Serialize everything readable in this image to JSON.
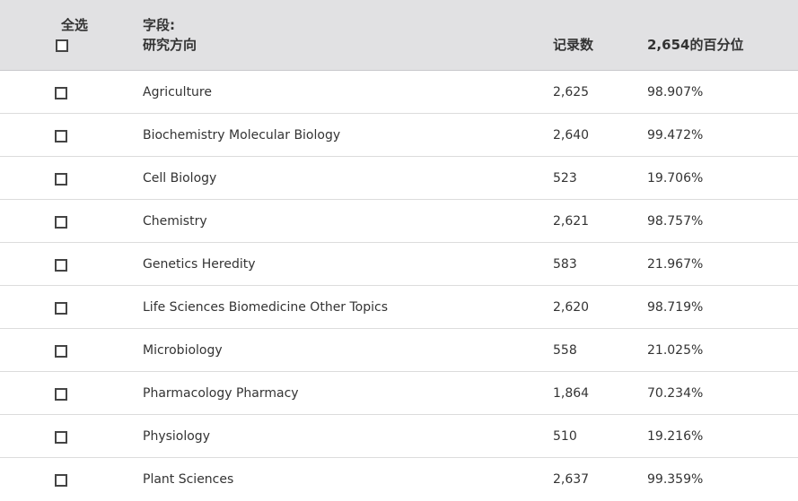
{
  "header": {
    "select_all": "全选",
    "field_label": "字段:",
    "field_name": "研究方向",
    "count": "记录数",
    "percent": "2,654的百分位"
  },
  "rows": [
    {
      "field": "Agriculture",
      "count": "2,625",
      "percent": "98.907%"
    },
    {
      "field": "Biochemistry Molecular Biology",
      "count": "2,640",
      "percent": "99.472%"
    },
    {
      "field": "Cell Biology",
      "count": "523",
      "percent": "19.706%"
    },
    {
      "field": "Chemistry",
      "count": "2,621",
      "percent": "98.757%"
    },
    {
      "field": "Genetics Heredity",
      "count": "583",
      "percent": "21.967%"
    },
    {
      "field": "Life Sciences Biomedicine Other Topics",
      "count": "2,620",
      "percent": "98.719%"
    },
    {
      "field": "Microbiology",
      "count": "558",
      "percent": "21.025%"
    },
    {
      "field": "Pharmacology Pharmacy",
      "count": "1,864",
      "percent": "70.234%"
    },
    {
      "field": "Physiology",
      "count": "510",
      "percent": "19.216%"
    },
    {
      "field": "Plant Sciences",
      "count": "2,637",
      "percent": "99.359%"
    }
  ]
}
